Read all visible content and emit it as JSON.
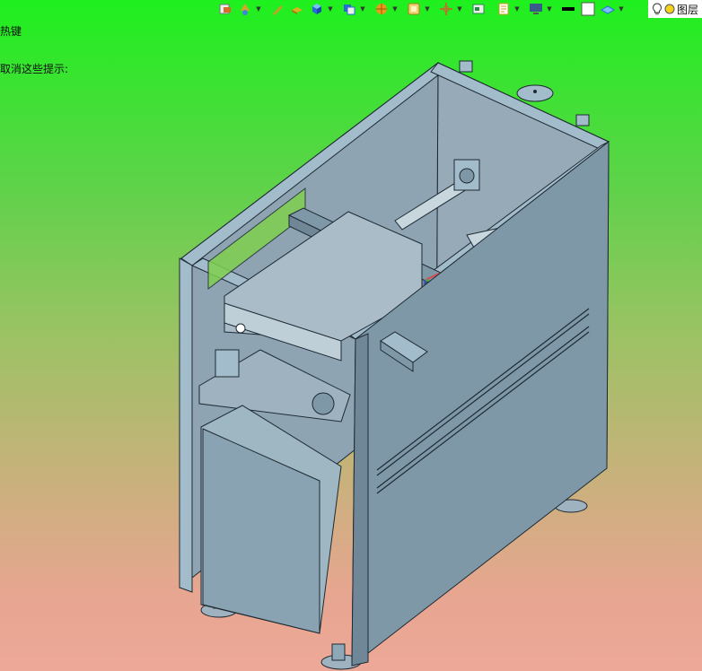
{
  "hint": {
    "line1": "热键",
    "line2": "取消这些提示:"
  },
  "toolbar": {
    "buttons": [
      {
        "name": "insert-component-icon",
        "color": "#d86a2a"
      },
      {
        "name": "smart-dimension-icon",
        "color": "#d8a62a"
      },
      {
        "name": "sketch-pencil-icon",
        "color": "#c2a22a"
      },
      {
        "name": "feature-extrude-icon",
        "color": "#e0b020"
      },
      {
        "name": "view-orientation-icon",
        "color": "#2a8ad8"
      },
      {
        "name": "display-style-icon",
        "color": "#2a6ad8"
      },
      {
        "name": "section-view-icon",
        "color": "#e89a1a"
      },
      {
        "name": "zoom-area-icon",
        "color": "#d8a62a"
      },
      {
        "name": "move-component-icon",
        "color": "#b07a2a"
      },
      {
        "name": "hide-show-icon",
        "color": "#2a8a4a"
      },
      {
        "name": "edit-appearance-icon",
        "color": "#c8a01a"
      },
      {
        "name": "monitor-display-icon",
        "color": "#3a5a8a"
      },
      {
        "name": "line-style-icon",
        "color": "#000000"
      },
      {
        "name": "scene-box-icon",
        "color": "#ffffff"
      },
      {
        "name": "apply-scene-icon",
        "color": "#3a8ad8"
      }
    ],
    "right_label": "图层"
  },
  "colors": {
    "frame_light": "#a3bccb",
    "frame_mid": "#8ea8b8",
    "frame_dark": "#6f8796",
    "panel_back": "#96aab7",
    "edge": "#1e2a33"
  }
}
